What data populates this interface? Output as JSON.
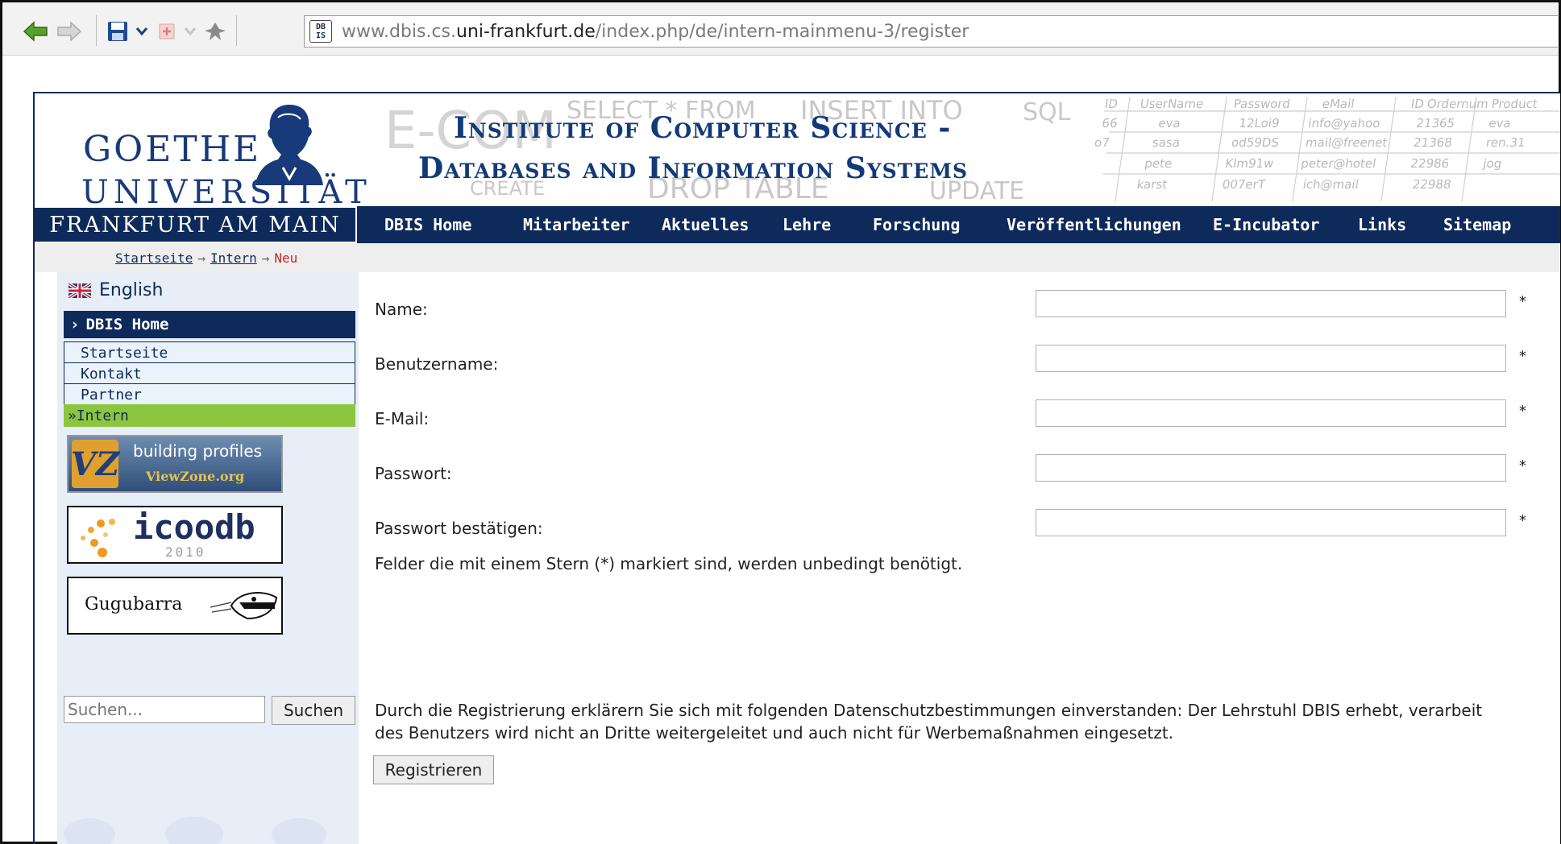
{
  "browser": {
    "url_prefix": "www.dbis.cs.",
    "url_host": "uni-frankfurt.de",
    "url_path": "/index.php/de/intern-mainmenu-3/register",
    "favicon_text": "DB IS"
  },
  "header": {
    "logo_line1": "GOETHE",
    "logo_line2": "UNIVERSITÄT",
    "logo_line3": "FRANKFURT AM MAIN",
    "title_line1": "Institute of Computer Science -",
    "title_line2": "Databases and Information Systems"
  },
  "nav": {
    "items": [
      {
        "label": "DBIS Home"
      },
      {
        "label": "Mitarbeiter"
      },
      {
        "label": "Aktuelles"
      },
      {
        "label": "Lehre"
      },
      {
        "label": "Forschung"
      },
      {
        "label": "Veröffentlichungen"
      },
      {
        "label": "E-Incubator"
      },
      {
        "label": "Links"
      },
      {
        "label": "Sitemap"
      }
    ]
  },
  "breadcrumb": {
    "items": [
      "Startseite",
      "Intern"
    ],
    "current": "Neu",
    "separator": "→"
  },
  "sidebar": {
    "language": "English",
    "menu_title": "DBIS Home",
    "menu_items": [
      {
        "label": "Startseite"
      },
      {
        "label": "Kontakt"
      },
      {
        "label": "Partner"
      },
      {
        "label": "Intern"
      }
    ],
    "ads": {
      "viewzone_line1": "building profiles",
      "viewzone_line2": "ViewZone.org",
      "icoodb_name": "icoodb",
      "icoodb_year": "2010",
      "gugubarra": "Gugubarra"
    },
    "search_placeholder": "Suchen...",
    "search_button": "Suchen"
  },
  "form": {
    "fields": [
      {
        "label": "Name:",
        "value": ""
      },
      {
        "label": "Benutzername:",
        "value": ""
      },
      {
        "label": "E-Mail:",
        "value": ""
      },
      {
        "label": "Passwort:",
        "value": ""
      },
      {
        "label": "Passwort bestätigen:",
        "value": ""
      }
    ],
    "required_marker": "*",
    "required_note": "Felder die mit einem Stern (*) markiert sind, werden unbedingt benötigt.",
    "privacy_line1": "Durch die Registrierung erklärern Sie sich mit folgenden Datenschutzbestimmungen einverstanden: Der Lehrstuhl DBIS erhebt, verarbeit",
    "privacy_line2": "des Benutzers wird nicht an Dritte weitergeleitet und auch nicht für Werbemaßnahmen eingesetzt.",
    "submit_label": "Registrieren"
  },
  "colors": {
    "navy": "#0e2a5a",
    "active_green": "#8cc63f",
    "breadcrumb_current": "#cc2222"
  }
}
